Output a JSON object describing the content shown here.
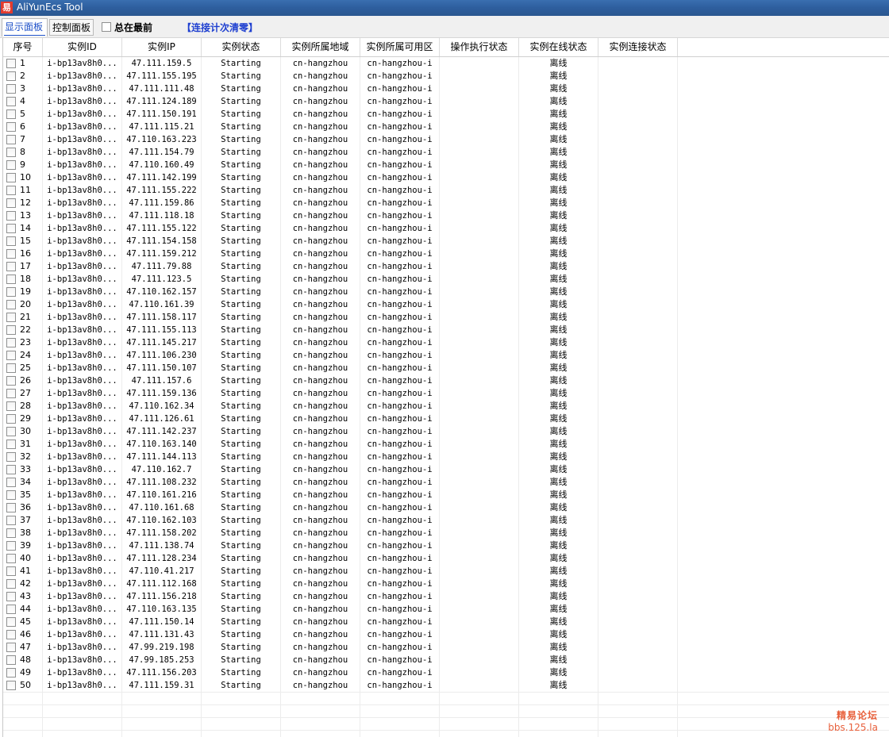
{
  "window": {
    "title": "AliYunEcs Tool",
    "icon": "app-icon"
  },
  "toolbar": {
    "tab_display": "显示面板",
    "tab_control": "控制面板",
    "always_on_top_label": "总在最前",
    "always_on_top_checked": false,
    "reset_count_label": "【连接计次清零】"
  },
  "table": {
    "columns": [
      "序号",
      "实例ID",
      "实例IP",
      "实例状态",
      "实例所属地域",
      "实例所属可用区",
      "操作执行状态",
      "实例在线状态",
      "实例连接状态"
    ],
    "rows": [
      [
        "1",
        "i-bp13av8h0...",
        "47.111.159.5",
        "Starting",
        "cn-hangzhou",
        "cn-hangzhou-i",
        "",
        "离线",
        ""
      ],
      [
        "2",
        "i-bp13av8h0...",
        "47.111.155.195",
        "Starting",
        "cn-hangzhou",
        "cn-hangzhou-i",
        "",
        "离线",
        ""
      ],
      [
        "3",
        "i-bp13av8h0...",
        "47.111.111.48",
        "Starting",
        "cn-hangzhou",
        "cn-hangzhou-i",
        "",
        "离线",
        ""
      ],
      [
        "4",
        "i-bp13av8h0...",
        "47.111.124.189",
        "Starting",
        "cn-hangzhou",
        "cn-hangzhou-i",
        "",
        "离线",
        ""
      ],
      [
        "5",
        "i-bp13av8h0...",
        "47.111.150.191",
        "Starting",
        "cn-hangzhou",
        "cn-hangzhou-i",
        "",
        "离线",
        ""
      ],
      [
        "6",
        "i-bp13av8h0...",
        "47.111.115.21",
        "Starting",
        "cn-hangzhou",
        "cn-hangzhou-i",
        "",
        "离线",
        ""
      ],
      [
        "7",
        "i-bp13av8h0...",
        "47.110.163.223",
        "Starting",
        "cn-hangzhou",
        "cn-hangzhou-i",
        "",
        "离线",
        ""
      ],
      [
        "8",
        "i-bp13av8h0...",
        "47.111.154.79",
        "Starting",
        "cn-hangzhou",
        "cn-hangzhou-i",
        "",
        "离线",
        ""
      ],
      [
        "9",
        "i-bp13av8h0...",
        "47.110.160.49",
        "Starting",
        "cn-hangzhou",
        "cn-hangzhou-i",
        "",
        "离线",
        ""
      ],
      [
        "10",
        "i-bp13av8h0...",
        "47.111.142.199",
        "Starting",
        "cn-hangzhou",
        "cn-hangzhou-i",
        "",
        "离线",
        ""
      ],
      [
        "11",
        "i-bp13av8h0...",
        "47.111.155.222",
        "Starting",
        "cn-hangzhou",
        "cn-hangzhou-i",
        "",
        "离线",
        ""
      ],
      [
        "12",
        "i-bp13av8h0...",
        "47.111.159.86",
        "Starting",
        "cn-hangzhou",
        "cn-hangzhou-i",
        "",
        "离线",
        ""
      ],
      [
        "13",
        "i-bp13av8h0...",
        "47.111.118.18",
        "Starting",
        "cn-hangzhou",
        "cn-hangzhou-i",
        "",
        "离线",
        ""
      ],
      [
        "14",
        "i-bp13av8h0...",
        "47.111.155.122",
        "Starting",
        "cn-hangzhou",
        "cn-hangzhou-i",
        "",
        "离线",
        ""
      ],
      [
        "15",
        "i-bp13av8h0...",
        "47.111.154.158",
        "Starting",
        "cn-hangzhou",
        "cn-hangzhou-i",
        "",
        "离线",
        ""
      ],
      [
        "16",
        "i-bp13av8h0...",
        "47.111.159.212",
        "Starting",
        "cn-hangzhou",
        "cn-hangzhou-i",
        "",
        "离线",
        ""
      ],
      [
        "17",
        "i-bp13av8h0...",
        "47.111.79.88",
        "Starting",
        "cn-hangzhou",
        "cn-hangzhou-i",
        "",
        "离线",
        ""
      ],
      [
        "18",
        "i-bp13av8h0...",
        "47.111.123.5",
        "Starting",
        "cn-hangzhou",
        "cn-hangzhou-i",
        "",
        "离线",
        ""
      ],
      [
        "19",
        "i-bp13av8h0...",
        "47.110.162.157",
        "Starting",
        "cn-hangzhou",
        "cn-hangzhou-i",
        "",
        "离线",
        ""
      ],
      [
        "20",
        "i-bp13av8h0...",
        "47.110.161.39",
        "Starting",
        "cn-hangzhou",
        "cn-hangzhou-i",
        "",
        "离线",
        ""
      ],
      [
        "21",
        "i-bp13av8h0...",
        "47.111.158.117",
        "Starting",
        "cn-hangzhou",
        "cn-hangzhou-i",
        "",
        "离线",
        ""
      ],
      [
        "22",
        "i-bp13av8h0...",
        "47.111.155.113",
        "Starting",
        "cn-hangzhou",
        "cn-hangzhou-i",
        "",
        "离线",
        ""
      ],
      [
        "23",
        "i-bp13av8h0...",
        "47.111.145.217",
        "Starting",
        "cn-hangzhou",
        "cn-hangzhou-i",
        "",
        "离线",
        ""
      ],
      [
        "24",
        "i-bp13av8h0...",
        "47.111.106.230",
        "Starting",
        "cn-hangzhou",
        "cn-hangzhou-i",
        "",
        "离线",
        ""
      ],
      [
        "25",
        "i-bp13av8h0...",
        "47.111.150.107",
        "Starting",
        "cn-hangzhou",
        "cn-hangzhou-i",
        "",
        "离线",
        ""
      ],
      [
        "26",
        "i-bp13av8h0...",
        "47.111.157.6",
        "Starting",
        "cn-hangzhou",
        "cn-hangzhou-i",
        "",
        "离线",
        ""
      ],
      [
        "27",
        "i-bp13av8h0...",
        "47.111.159.136",
        "Starting",
        "cn-hangzhou",
        "cn-hangzhou-i",
        "",
        "离线",
        ""
      ],
      [
        "28",
        "i-bp13av8h0...",
        "47.110.162.34",
        "Starting",
        "cn-hangzhou",
        "cn-hangzhou-i",
        "",
        "离线",
        ""
      ],
      [
        "29",
        "i-bp13av8h0...",
        "47.111.126.61",
        "Starting",
        "cn-hangzhou",
        "cn-hangzhou-i",
        "",
        "离线",
        ""
      ],
      [
        "30",
        "i-bp13av8h0...",
        "47.111.142.237",
        "Starting",
        "cn-hangzhou",
        "cn-hangzhou-i",
        "",
        "离线",
        ""
      ],
      [
        "31",
        "i-bp13av8h0...",
        "47.110.163.140",
        "Starting",
        "cn-hangzhou",
        "cn-hangzhou-i",
        "",
        "离线",
        ""
      ],
      [
        "32",
        "i-bp13av8h0...",
        "47.111.144.113",
        "Starting",
        "cn-hangzhou",
        "cn-hangzhou-i",
        "",
        "离线",
        ""
      ],
      [
        "33",
        "i-bp13av8h0...",
        "47.110.162.7",
        "Starting",
        "cn-hangzhou",
        "cn-hangzhou-i",
        "",
        "离线",
        ""
      ],
      [
        "34",
        "i-bp13av8h0...",
        "47.111.108.232",
        "Starting",
        "cn-hangzhou",
        "cn-hangzhou-i",
        "",
        "离线",
        ""
      ],
      [
        "35",
        "i-bp13av8h0...",
        "47.110.161.216",
        "Starting",
        "cn-hangzhou",
        "cn-hangzhou-i",
        "",
        "离线",
        ""
      ],
      [
        "36",
        "i-bp13av8h0...",
        "47.110.161.68",
        "Starting",
        "cn-hangzhou",
        "cn-hangzhou-i",
        "",
        "离线",
        ""
      ],
      [
        "37",
        "i-bp13av8h0...",
        "47.110.162.103",
        "Starting",
        "cn-hangzhou",
        "cn-hangzhou-i",
        "",
        "离线",
        ""
      ],
      [
        "38",
        "i-bp13av8h0...",
        "47.111.158.202",
        "Starting",
        "cn-hangzhou",
        "cn-hangzhou-i",
        "",
        "离线",
        ""
      ],
      [
        "39",
        "i-bp13av8h0...",
        "47.111.138.74",
        "Starting",
        "cn-hangzhou",
        "cn-hangzhou-i",
        "",
        "离线",
        ""
      ],
      [
        "40",
        "i-bp13av8h0...",
        "47.111.128.234",
        "Starting",
        "cn-hangzhou",
        "cn-hangzhou-i",
        "",
        "离线",
        ""
      ],
      [
        "41",
        "i-bp13av8h0...",
        "47.110.41.217",
        "Starting",
        "cn-hangzhou",
        "cn-hangzhou-i",
        "",
        "离线",
        ""
      ],
      [
        "42",
        "i-bp13av8h0...",
        "47.111.112.168",
        "Starting",
        "cn-hangzhou",
        "cn-hangzhou-i",
        "",
        "离线",
        ""
      ],
      [
        "43",
        "i-bp13av8h0...",
        "47.111.156.218",
        "Starting",
        "cn-hangzhou",
        "cn-hangzhou-i",
        "",
        "离线",
        ""
      ],
      [
        "44",
        "i-bp13av8h0...",
        "47.110.163.135",
        "Starting",
        "cn-hangzhou",
        "cn-hangzhou-i",
        "",
        "离线",
        ""
      ],
      [
        "45",
        "i-bp13av8h0...",
        "47.111.150.14",
        "Starting",
        "cn-hangzhou",
        "cn-hangzhou-i",
        "",
        "离线",
        ""
      ],
      [
        "46",
        "i-bp13av8h0...",
        "47.111.131.43",
        "Starting",
        "cn-hangzhou",
        "cn-hangzhou-i",
        "",
        "离线",
        ""
      ],
      [
        "47",
        "i-bp13av8h0...",
        "47.99.219.198",
        "Starting",
        "cn-hangzhou",
        "cn-hangzhou-i",
        "",
        "离线",
        ""
      ],
      [
        "48",
        "i-bp13av8h0...",
        "47.99.185.253",
        "Starting",
        "cn-hangzhou",
        "cn-hangzhou-i",
        "",
        "离线",
        ""
      ],
      [
        "49",
        "i-bp13av8h0...",
        "47.111.156.203",
        "Starting",
        "cn-hangzhou",
        "cn-hangzhou-i",
        "",
        "离线",
        ""
      ],
      [
        "50",
        "i-bp13av8h0...",
        "47.111.159.31",
        "Starting",
        "cn-hangzhou",
        "cn-hangzhou-i",
        "",
        "离线",
        ""
      ]
    ]
  },
  "watermark": {
    "line1": "精易论坛",
    "line2": "bbs.125.la"
  },
  "colors": {
    "title_bar": "#2e5f9f",
    "accent_blue": "#1e3fd0",
    "watermark": "#e8603c"
  }
}
